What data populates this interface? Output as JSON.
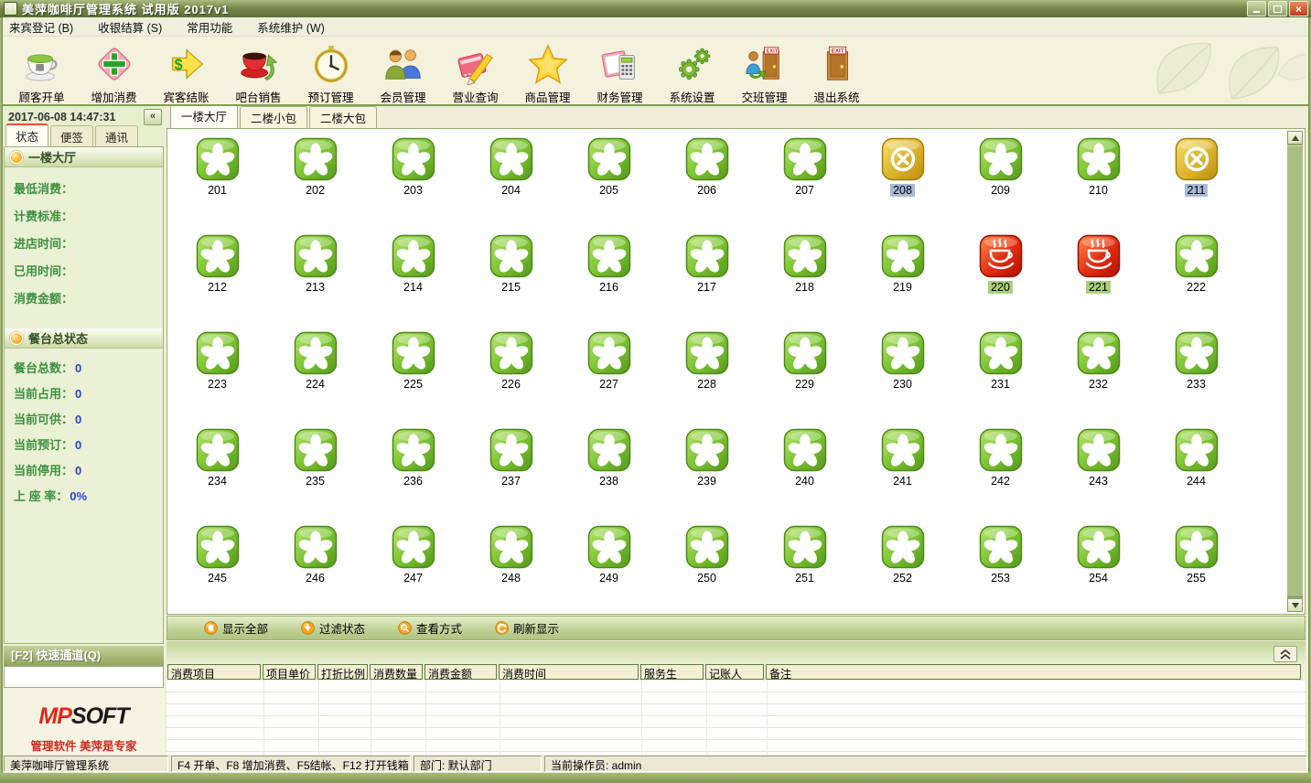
{
  "window": {
    "title": "美萍咖啡厅管理系统 试用版  2017v1"
  },
  "menu": {
    "items": [
      "来宾登记 (B)",
      "收银结算 (S)",
      "常用功能",
      "系统维护 (W)"
    ]
  },
  "toolbar": {
    "items": [
      "顾客开单",
      "增加消费",
      "宾客结账",
      "吧台销售",
      "预订管理",
      "会员管理",
      "营业查询",
      "商品管理",
      "财务管理",
      "系统设置",
      "交班管理",
      "退出系统"
    ]
  },
  "sidebar": {
    "datetime": "2017-06-08 14:47:31",
    "collapse_label": "«",
    "tabs": [
      "状态",
      "便签",
      "通讯"
    ],
    "active_tab": "状态",
    "section1": {
      "title": "一楼大厅",
      "fields": [
        "最低消费：",
        "计费标准：",
        "进店时间：",
        "已用时间：",
        "消费金额："
      ]
    },
    "section2": {
      "title": "餐台总状态",
      "stats": [
        {
          "label": "餐台总数：",
          "value": "0"
        },
        {
          "label": "当前占用：",
          "value": "0"
        },
        {
          "label": "当前可供：",
          "value": "0"
        },
        {
          "label": "当前预订：",
          "value": "0"
        },
        {
          "label": "当前停用：",
          "value": "0"
        },
        {
          "label": "上 座 率：",
          "value": "0%"
        }
      ]
    },
    "quick_bar": "[F2] 快速通道(Q)",
    "quick_input_value": "",
    "logo": {
      "mp": "MP",
      "soft": "SOFT",
      "slogan": "管理软件  美萍是专家"
    }
  },
  "main": {
    "tabs": [
      "一楼大厅",
      "二楼小包",
      "二楼大包"
    ],
    "active_tab": "一楼大厅",
    "tables": [
      {
        "num": "201",
        "state": "free"
      },
      {
        "num": "202",
        "state": "free"
      },
      {
        "num": "203",
        "state": "free"
      },
      {
        "num": "204",
        "state": "free"
      },
      {
        "num": "205",
        "state": "free"
      },
      {
        "num": "206",
        "state": "free"
      },
      {
        "num": "207",
        "state": "free"
      },
      {
        "num": "208",
        "state": "stopped"
      },
      {
        "num": "209",
        "state": "free"
      },
      {
        "num": "210",
        "state": "free"
      },
      {
        "num": "211",
        "state": "stopped"
      },
      {
        "num": "212",
        "state": "free"
      },
      {
        "num": "213",
        "state": "free"
      },
      {
        "num": "214",
        "state": "free"
      },
      {
        "num": "215",
        "state": "free"
      },
      {
        "num": "216",
        "state": "free"
      },
      {
        "num": "217",
        "state": "free"
      },
      {
        "num": "218",
        "state": "free"
      },
      {
        "num": "219",
        "state": "free"
      },
      {
        "num": "220",
        "state": "occupied"
      },
      {
        "num": "221",
        "state": "occupied"
      },
      {
        "num": "222",
        "state": "free"
      },
      {
        "num": "223",
        "state": "free"
      },
      {
        "num": "224",
        "state": "free"
      },
      {
        "num": "225",
        "state": "free"
      },
      {
        "num": "226",
        "state": "free"
      },
      {
        "num": "227",
        "state": "free"
      },
      {
        "num": "228",
        "state": "free"
      },
      {
        "num": "229",
        "state": "free"
      },
      {
        "num": "230",
        "state": "free"
      },
      {
        "num": "231",
        "state": "free"
      },
      {
        "num": "232",
        "state": "free"
      },
      {
        "num": "233",
        "state": "free"
      },
      {
        "num": "234",
        "state": "free"
      },
      {
        "num": "235",
        "state": "free"
      },
      {
        "num": "236",
        "state": "free"
      },
      {
        "num": "237",
        "state": "free"
      },
      {
        "num": "238",
        "state": "free"
      },
      {
        "num": "239",
        "state": "free"
      },
      {
        "num": "240",
        "state": "free"
      },
      {
        "num": "241",
        "state": "free"
      },
      {
        "num": "242",
        "state": "free"
      },
      {
        "num": "243",
        "state": "free"
      },
      {
        "num": "244",
        "state": "free"
      },
      {
        "num": "245",
        "state": "free"
      },
      {
        "num": "246",
        "state": "free"
      },
      {
        "num": "247",
        "state": "free"
      },
      {
        "num": "248",
        "state": "free"
      },
      {
        "num": "249",
        "state": "free"
      },
      {
        "num": "250",
        "state": "free"
      },
      {
        "num": "251",
        "state": "free"
      },
      {
        "num": "252",
        "state": "free"
      },
      {
        "num": "253",
        "state": "free"
      },
      {
        "num": "254",
        "state": "free"
      },
      {
        "num": "255",
        "state": "free"
      }
    ],
    "filter_toolbar": {
      "buttons": [
        "显示全部",
        "过滤状态",
        "查看方式",
        "刷新显示"
      ]
    },
    "detail_table": {
      "columns": [
        "消费项目",
        "项目单价",
        "打折比例",
        "消费数量",
        "消费金额",
        "消费时间",
        "服务生",
        "记账人",
        "备注"
      ],
      "rows": []
    }
  },
  "statusbar": {
    "segments": [
      "美萍咖啡厅管理系统",
      "F4 开单、F8 增加消费、F5结帐、F12 打开钱箱",
      "部门: 默认部门",
      "当前操作员: admin"
    ]
  },
  "colors": {
    "accent_green": "#7cc432",
    "state_free": "#7cc432",
    "state_stopped": "#dcb32e",
    "state_occupied": "#e22c12",
    "stopped_label_bg": "#a6bad6",
    "occupied_label_bg": "#a9cf7d",
    "frame_olive": "#77894b"
  }
}
